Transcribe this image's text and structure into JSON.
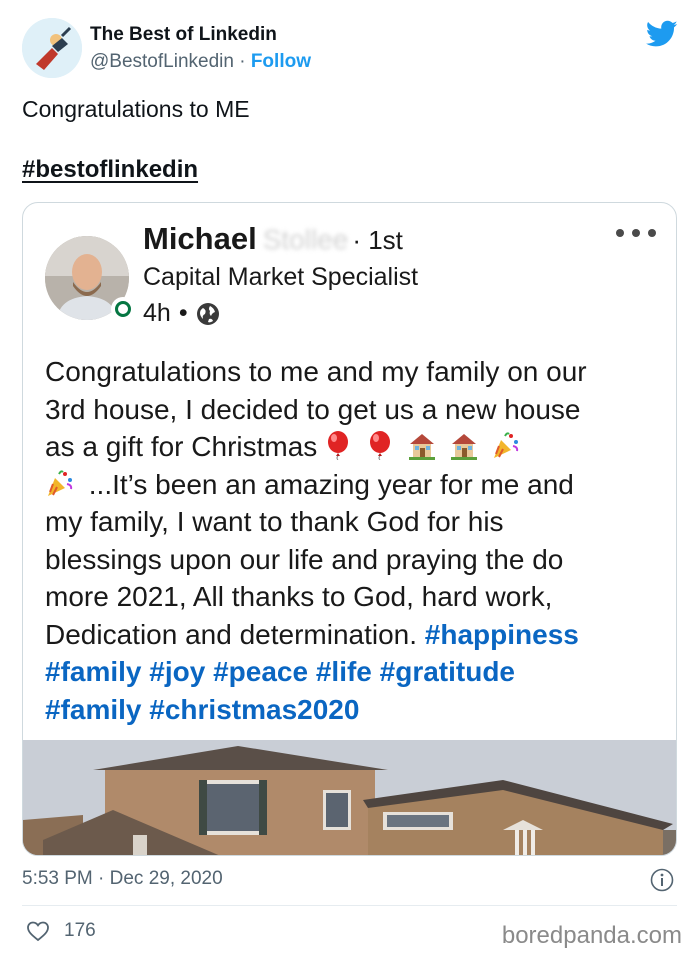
{
  "tweet": {
    "author": {
      "name": "The Best of Linkedin",
      "handle": "@BestofLinkedin",
      "separator": "·",
      "follow_label": "Follow"
    },
    "text": "Congratulations to ME",
    "hashtag": "#bestoflinkedin",
    "timestamp": "5:53 PM · Dec 29, 2020",
    "likes": "176"
  },
  "linkedin_post": {
    "author_name": "Michael",
    "author_name_blurred": "Stollee",
    "connection": "· 1st",
    "author_title": "Capital Market Specialist",
    "time_ago": "4h",
    "time_sep": "•",
    "line1": "Congratulations to me and my family on our",
    "line2": "3rd house, I decided to get us a new house",
    "line3": "as a gift for Christmas",
    "line4": "...It’s been an amazing year for me and",
    "line5": "my family, I want to thank God for his",
    "line6": "blessings upon our life and praying the do",
    "line7": "more 2021, All thanks to God, hard work,",
    "line8": "Dedication and determination.",
    "tag_happiness": "#happiness",
    "tag_family": "#family",
    "tag_joy": "#joy",
    "tag_peace": "#peace",
    "tag_life": "#life",
    "tag_gratitude": "#gratitude",
    "tag_family2": "#family",
    "tag_christmas": "#christmas2020"
  },
  "watermark": "boredpanda.com",
  "icons": {
    "bird": "twitter-bird-icon",
    "heart": "heart-icon",
    "info": "info-icon",
    "globe": "globe-icon",
    "more": "more-options-icon",
    "balloon": "balloon-icon",
    "house": "house-icon",
    "party": "party-popper-icon"
  },
  "colors": {
    "twitter_blue": "#1d9bf0",
    "linkedin_link": "#0a66c2",
    "online_green": "#057642"
  }
}
